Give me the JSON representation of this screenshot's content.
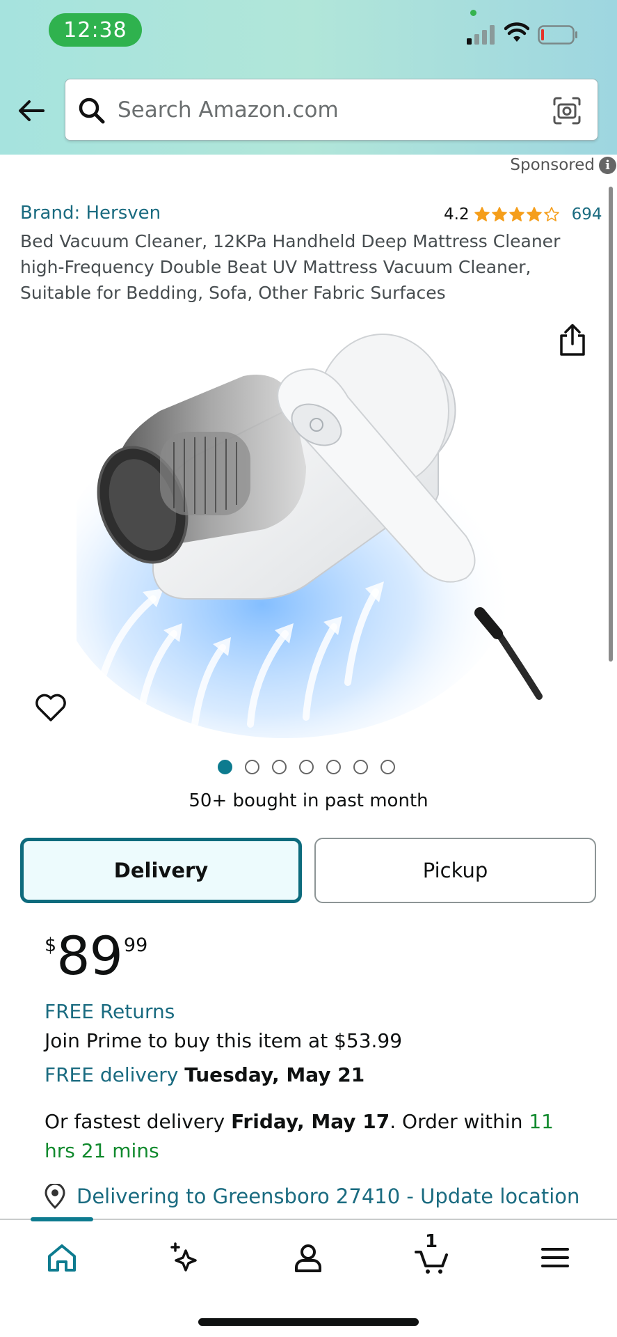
{
  "status_bar": {
    "time": "12:38"
  },
  "search": {
    "placeholder": "Search Amazon.com"
  },
  "sponsored_label": "Sponsored",
  "product": {
    "brand": "Brand: Hersven",
    "rating": "4.2",
    "rating_value": 4.2,
    "review_count": "694",
    "title": "Bed Vacuum Cleaner, 12KPa Handheld Deep Mattress Cleaner high-Frequency Double Beat UV Mattress Vacuum Cleaner, Suitable for Bedding, Sofa, Other Fabric Surfaces",
    "image_count": 7,
    "active_image": 1,
    "bought_text": "50+ bought in past month"
  },
  "tabs": {
    "delivery": "Delivery",
    "pickup": "Pickup"
  },
  "price": {
    "symbol": "$",
    "whole": "89",
    "fraction": "99"
  },
  "offers": {
    "free_returns": "FREE Returns",
    "prime_text": "Join Prime to buy this item at $53.99",
    "free_delivery_label": "FREE delivery",
    "free_delivery_date": "Tuesday, May 21",
    "fastest_prefix": "Or fastest delivery ",
    "fastest_date": "Friday, May 17",
    "fastest_mid": ". Order within ",
    "fastest_time": "11 hrs 21 mins"
  },
  "location": {
    "text": "Delivering to Greensboro 27410 - Update location"
  },
  "nav": {
    "cart_count": "1"
  },
  "colors": {
    "teal": "#1a6b80",
    "green": "#118a2e",
    "star": "#f59e1b",
    "accent": "#0d7b8f"
  }
}
